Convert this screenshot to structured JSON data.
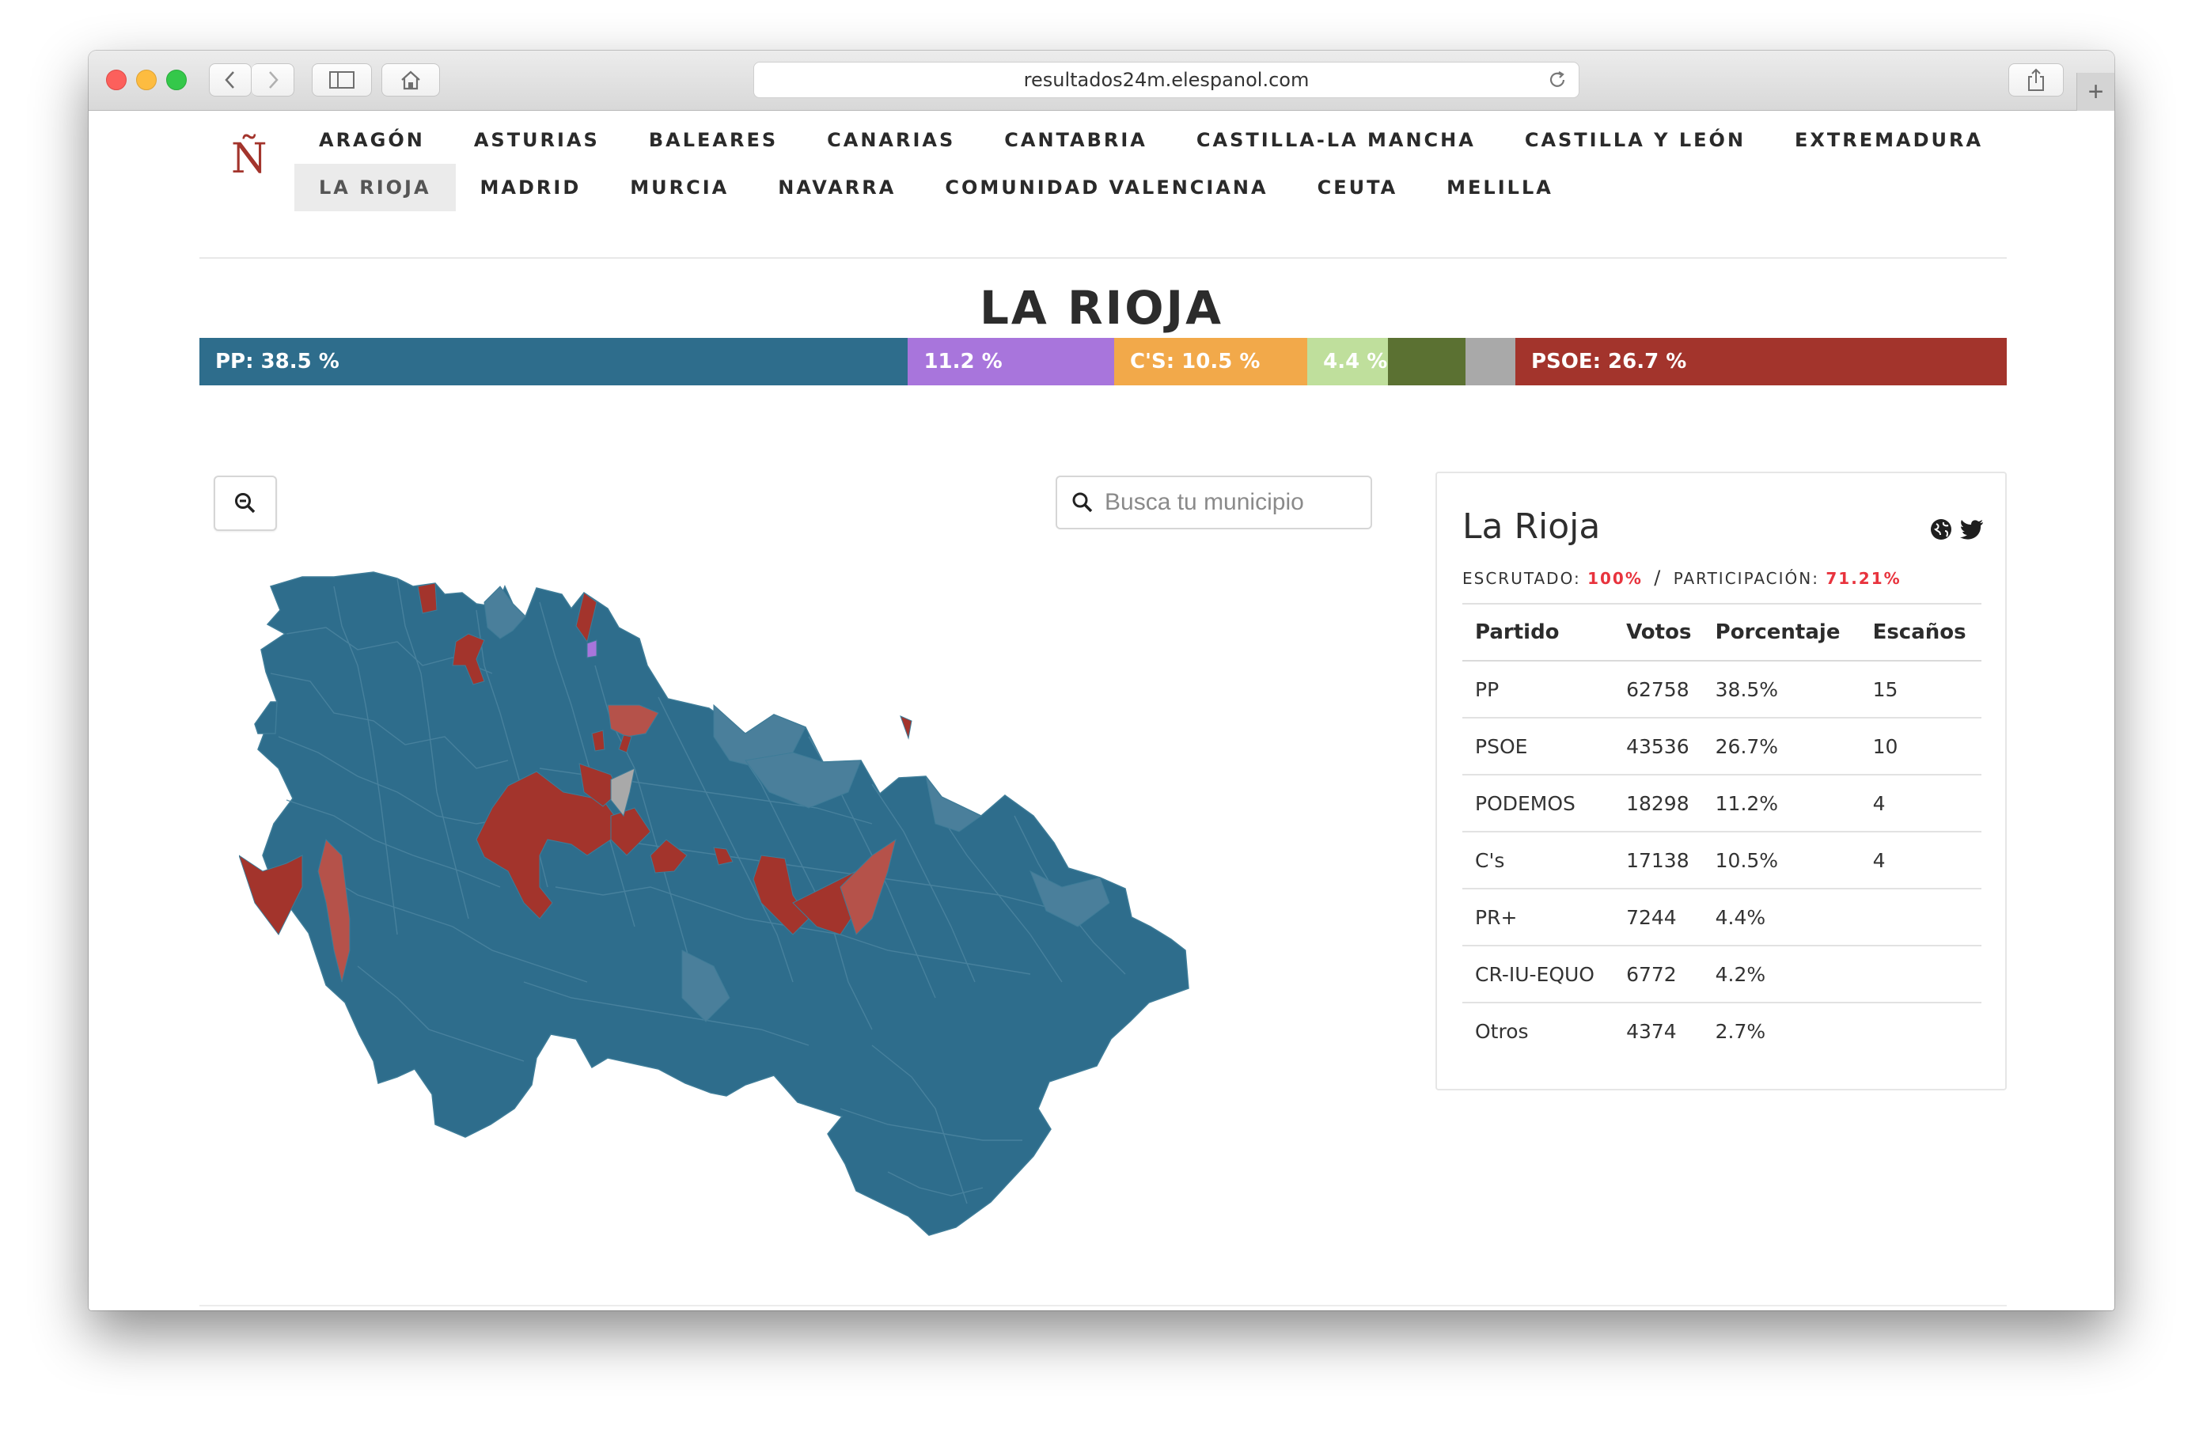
{
  "browser": {
    "url": "resultados24m.elespanol.com",
    "newtab_label": "+"
  },
  "site": {
    "logo": "Ñ"
  },
  "nav": {
    "row1": [
      "ARAGÓN",
      "ASTURIAS",
      "BALEARES",
      "CANARIAS",
      "CANTABRIA",
      "CASTILLA-LA MANCHA",
      "CASTILLA Y LEÓN",
      "EXTREMADURA"
    ],
    "row2": [
      "LA RIOJA",
      "MADRID",
      "MURCIA",
      "NAVARRA",
      "COMUNIDAD VALENCIANA",
      "CEUTA",
      "MELILLA"
    ],
    "active": "LA RIOJA"
  },
  "page": {
    "title": "LA RIOJA"
  },
  "vote_bar": [
    {
      "party": "PP",
      "label": "PP: 38.5 %",
      "percent": 38.5,
      "color": "#2e6d8c"
    },
    {
      "party": "PODEMOS",
      "label": "11.2 %",
      "percent": 11.2,
      "color": "#a875dc"
    },
    {
      "party": "C's",
      "label": "C'S: 10.5 %",
      "percent": 10.5,
      "color": "#f2a94a"
    },
    {
      "party": "PR+",
      "label": "4.4 %",
      "percent": 4.4,
      "color": "#bfdf9c"
    },
    {
      "party": "CR-IU-EQUO",
      "label": "",
      "percent": 4.2,
      "color": "#5b7132"
    },
    {
      "party": "Otros",
      "label": "",
      "percent": 2.7,
      "color": "#a9a9a9"
    },
    {
      "party": "PSOE",
      "label": "PSOE: 26.7 %",
      "percent": 26.7,
      "color": "#a3342c"
    }
  ],
  "search": {
    "placeholder": "Busca tu municipio",
    "icon": "search-icon"
  },
  "zoom": {
    "icon": "zoom-out-icon"
  },
  "map": {
    "colors": {
      "pp": "#2e6d8c",
      "pp_light": "#4a7f9b",
      "psoe": "#a3342c",
      "psoe_light": "#b5524a",
      "podemos": "#a875dc",
      "otros": "#a9a9a9"
    }
  },
  "panel": {
    "title": "La Rioja",
    "icons": [
      "globe-icon",
      "twitter-icon"
    ],
    "escrutado_label": "ESCRUTADO:",
    "escrutado_value": "100%",
    "separator": "/",
    "participacion_label": "PARTICIPACIÓN:",
    "participacion_value": "71.21%",
    "headers": [
      "Partido",
      "Votos",
      "Porcentaje",
      "Escaños"
    ],
    "rows": [
      [
        "PP",
        "62758",
        "38.5%",
        "15"
      ],
      [
        "PSOE",
        "43536",
        "26.7%",
        "10"
      ],
      [
        "PODEMOS",
        "18298",
        "11.2%",
        "4"
      ],
      [
        "C's",
        "17138",
        "10.5%",
        "4"
      ],
      [
        "PR+",
        "7244",
        "4.4%",
        ""
      ],
      [
        "CR-IU-EQUO",
        "6772",
        "4.2%",
        ""
      ],
      [
        "Otros",
        "4374",
        "2.7%",
        ""
      ]
    ]
  }
}
